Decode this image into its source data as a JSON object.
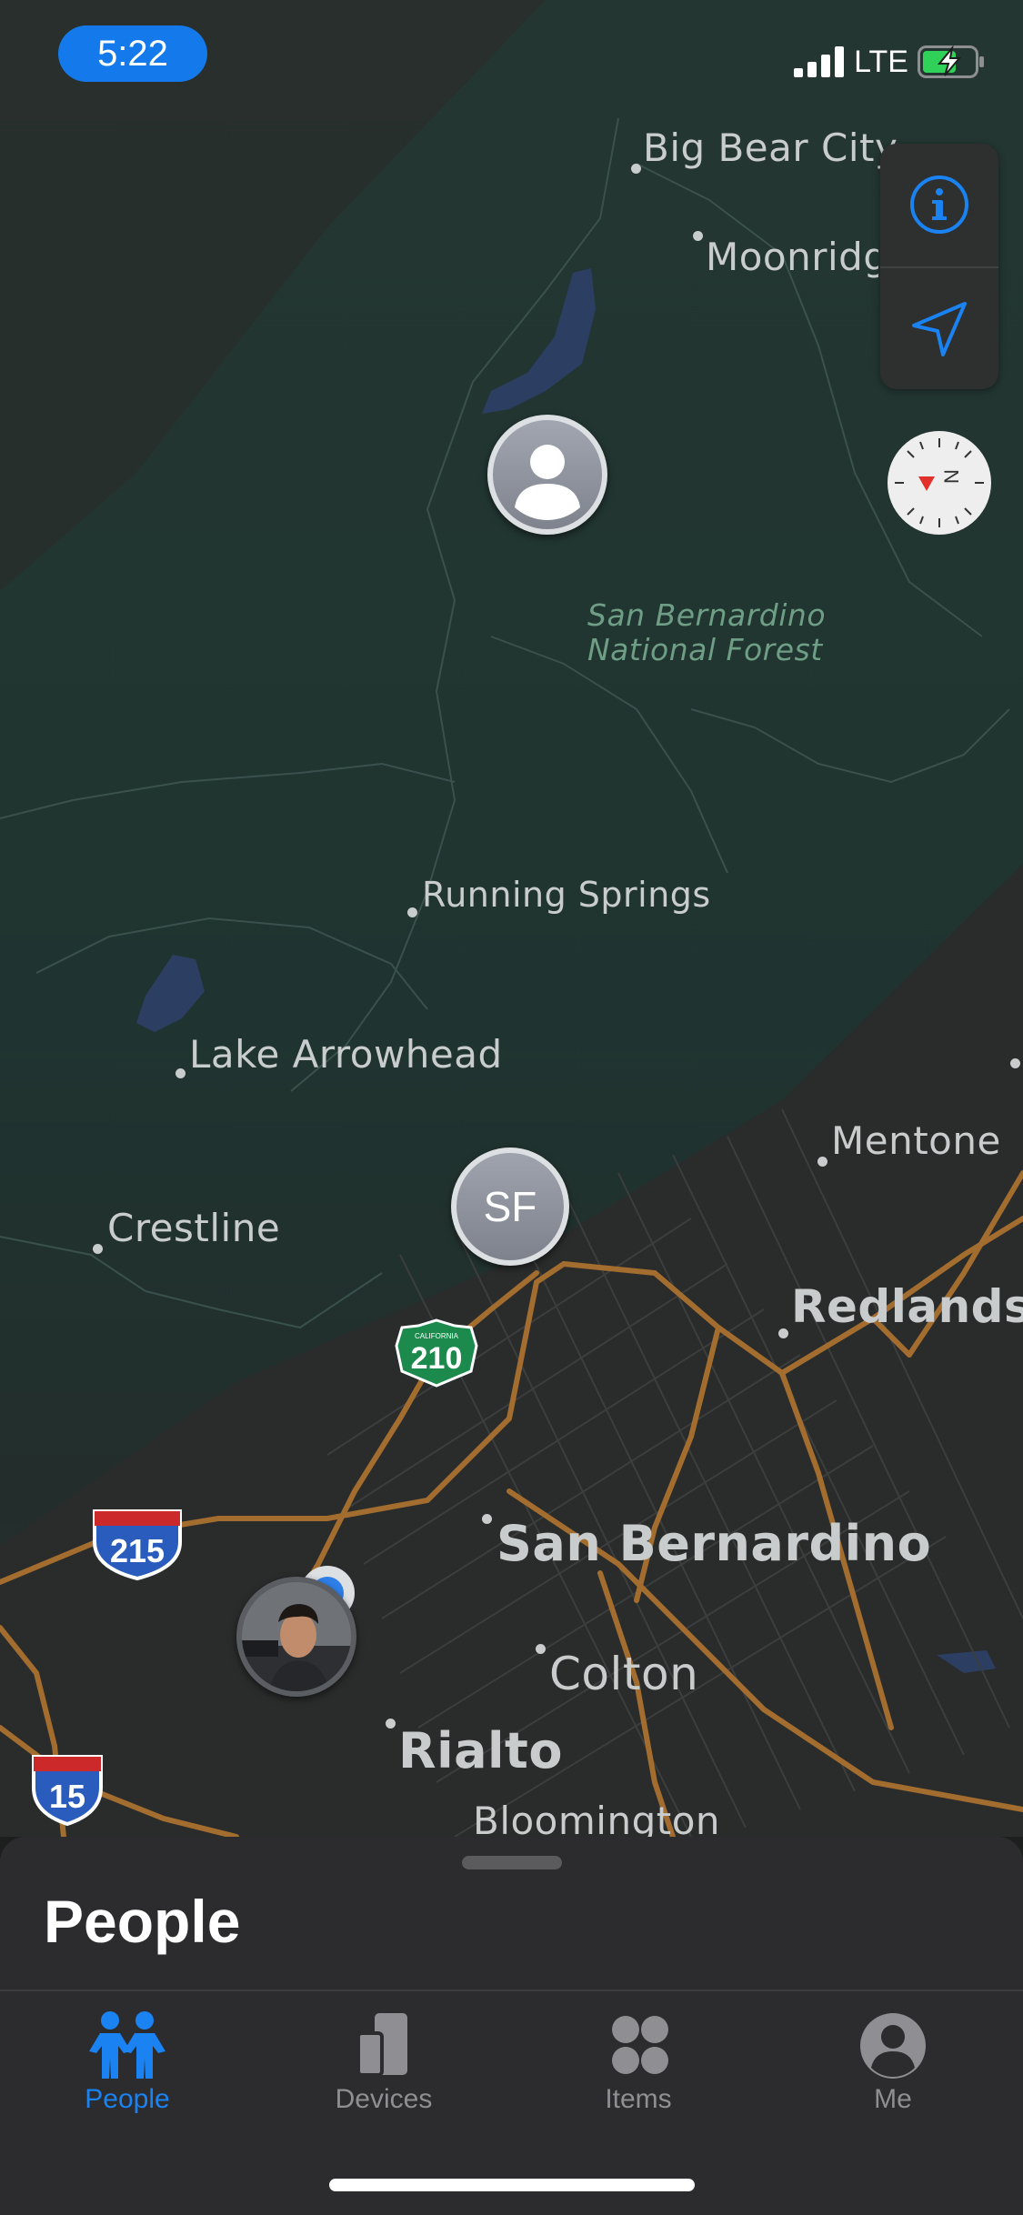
{
  "status_bar": {
    "time": "5:22",
    "network": "LTE"
  },
  "map_controls": {
    "info_icon": "info-icon",
    "location_icon": "location-arrow-icon",
    "compass_icon": "compass-icon"
  },
  "map": {
    "places": [
      {
        "name": "Big Bear City"
      },
      {
        "name": "Moonridge"
      },
      {
        "name": "San Bernardino National Forest",
        "lines": [
          "San Bernardino",
          "National Forest"
        ]
      },
      {
        "name": "Running Springs"
      },
      {
        "name": "Lake Arrowhead"
      },
      {
        "name": "Mentone"
      },
      {
        "name": "Crestline"
      },
      {
        "name": "Redlands"
      },
      {
        "name": "San Bernardino"
      },
      {
        "name": "Colton"
      },
      {
        "name": "Rialto"
      },
      {
        "name": "Bloomington"
      }
    ],
    "shields": [
      {
        "id": "ca-210",
        "label": "210",
        "top_text": "CALIFORNIA"
      },
      {
        "id": "i-215",
        "label": "215"
      },
      {
        "id": "i-15",
        "label": "15"
      }
    ],
    "pins": [
      {
        "id": "generic-person"
      },
      {
        "id": "sf",
        "initials": "SF"
      },
      {
        "id": "photo-person"
      }
    ]
  },
  "sheet": {
    "title": "People"
  },
  "tabs": [
    {
      "label": "People",
      "icon": "people-icon",
      "active": true
    },
    {
      "label": "Devices",
      "icon": "devices-icon",
      "active": false
    },
    {
      "label": "Items",
      "icon": "items-icon",
      "active": false
    },
    {
      "label": "Me",
      "icon": "me-icon",
      "active": false
    }
  ],
  "colors": {
    "accent": "#1a82f1",
    "map_bg": "#1f3330",
    "road": "#a26d2e",
    "water": "#2c3f63"
  }
}
